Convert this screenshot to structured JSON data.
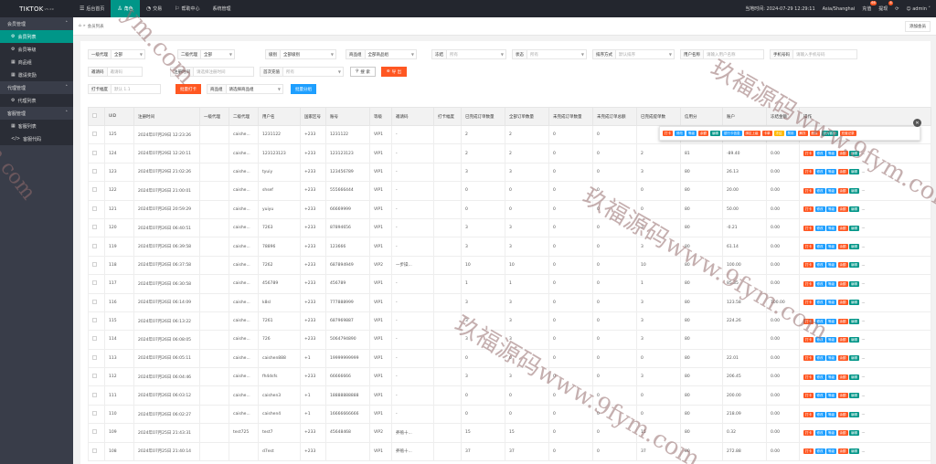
{
  "app": {
    "logo": "TIKTOK",
    "logo_sup": "V5.09"
  },
  "nav": [
    {
      "label": "后台首页",
      "icon": "☰"
    },
    {
      "label": "角色",
      "icon": "♙",
      "active": true
    },
    {
      "label": "交易",
      "icon": "◔"
    },
    {
      "label": "帮助中心",
      "icon": "⚐"
    },
    {
      "label": "系统管理",
      "icon": ""
    }
  ],
  "topright": {
    "time_label": "当地时间: 2024-07-29 12:29:11",
    "timezone": "Asia/Shanghai",
    "recharge": "充值",
    "recharge_badge": "66",
    "withdraw": "提现",
    "withdraw_badge": "6",
    "refresh_icon": "⟳",
    "user": "admin"
  },
  "sidebar": [
    {
      "type": "group",
      "label": "会员管理",
      "chev": "˄"
    },
    {
      "type": "item",
      "label": "会员列表",
      "icon": "⚙",
      "active": true
    },
    {
      "type": "item",
      "label": "会员等级",
      "icon": "⚙"
    },
    {
      "type": "item",
      "label": "商品组",
      "icon": "▦"
    },
    {
      "type": "item",
      "label": "邀请奖励",
      "icon": "▦"
    },
    {
      "type": "group",
      "label": "代理管理",
      "chev": "˄"
    },
    {
      "type": "item",
      "label": "代理列表",
      "icon": "⚙"
    },
    {
      "type": "group",
      "label": "客服管理",
      "chev": "˄"
    },
    {
      "type": "item",
      "label": "客服列表",
      "icon": "▦"
    },
    {
      "type": "item",
      "label": "客服代码",
      "icon": "</>"
    }
  ],
  "tabbar": {
    "home_icon": "⌂",
    "sep": "»",
    "tab": "会员列表",
    "add_btn": "添加会员"
  },
  "filters": {
    "agent1": {
      "label": "一级代理",
      "value": "全部"
    },
    "agent2": {
      "label": "二级代理",
      "value": "全部"
    },
    "level": {
      "label": "级别",
      "value": "全部级别"
    },
    "group": {
      "label": "商品组",
      "value": "全部商品组"
    },
    "frozen": {
      "label": "冻结",
      "value": "所有"
    },
    "status": {
      "label": "状态",
      "value": "所有"
    },
    "sort": {
      "label": "排序方式",
      "value": "默认排序"
    },
    "username": {
      "label": "用户名称",
      "value": "请输入用户名称"
    },
    "phone": {
      "label": "手机号码",
      "value": "请输入手机号码"
    },
    "invite": {
      "label": "邀请码",
      "value": "邀请码"
    },
    "regtime": {
      "label": "注册时间",
      "value": "请选择注册时间"
    },
    "first": {
      "label": "首次充值",
      "value": "所有"
    },
    "search_btn": "搜 索",
    "reset_btn": "导 出",
    "punch": {
      "label": "打卡幅度",
      "value": "默认 1.1"
    },
    "batch_punch": "批量打卡",
    "group2": {
      "label": "商品组",
      "value": "请选择商品组"
    },
    "batch_group": "批量分组"
  },
  "columns": [
    "UID",
    "注册时间",
    "一级代理",
    "二级代理",
    "用户名",
    "国家区号",
    "账号",
    "等级",
    "邀请码",
    "打卡幅度",
    "已完成订单数量",
    "全部订单数量",
    "未完成订单数量",
    "未完成订单总额",
    "已完成提单数",
    "信用分",
    "账户",
    "冻结金额",
    "操作"
  ],
  "rows": [
    [
      "125",
      "2024年07月29日 12:23:26",
      "",
      "caishe...",
      "1231122",
      "+233",
      "1231122",
      "VIP1",
      "-",
      "",
      "2",
      "2",
      "0",
      "0",
      "",
      "",
      "",
      "",
      ""
    ],
    [
      "124",
      "2024年07月29日 12:20:11",
      "",
      "caishe...",
      "123123123",
      "+233",
      "123123123",
      "VIP1",
      "-",
      "",
      "2",
      "2",
      "0",
      "0",
      "2",
      "81",
      "-89.40",
      "0.00",
      ""
    ],
    [
      "123",
      "2024年07月29日 21:02:26",
      "",
      "caishe...",
      "tyuiy",
      "+233",
      "123456789",
      "VIP1",
      "-",
      "",
      "3",
      "3",
      "0",
      "0",
      "3",
      "80",
      "26.13",
      "0.00",
      ""
    ],
    [
      "122",
      "2024年07月26日 21:00:01",
      "",
      "caishe...",
      "shsef",
      "+233",
      "555666444",
      "VIP1",
      "-",
      "",
      "0",
      "0",
      "0",
      "0",
      "0",
      "80",
      "20.00",
      "0.00",
      ""
    ],
    [
      "121",
      "2024年07月26日 20:59:29",
      "",
      "caishe...",
      "yuiyu",
      "+233",
      "66669999",
      "VIP1",
      "-",
      "",
      "0",
      "0",
      "0",
      "0",
      "0",
      "80",
      "50.00",
      "0.00",
      ""
    ],
    [
      "120",
      "2024年07月26日 06:40:51",
      "",
      "caishe...",
      "7263",
      "+233",
      "87894656",
      "VIP1",
      "-",
      "",
      "3",
      "3",
      "0",
      "0",
      "3",
      "80",
      "-0.21",
      "0.00",
      ""
    ],
    [
      "119",
      "2024年07月26日 06:39:58",
      "",
      "caishe...",
      "78896",
      "+233",
      "123666",
      "VIP1",
      "-",
      "",
      "3",
      "3",
      "0",
      "0",
      "3",
      "80",
      "61.14",
      "0.00",
      ""
    ],
    [
      "118",
      "2024年07月26日 06:37:58",
      "",
      "caishe...",
      "7262",
      "+233",
      "687894949",
      "VIP2",
      "一步操...",
      "",
      "10",
      "10",
      "0",
      "0",
      "10",
      "80",
      "100.00",
      "0.00",
      ""
    ],
    [
      "117",
      "2024年07月26日 06:30:58",
      "",
      "caishe...",
      "456789",
      "+233",
      "456789",
      "VIP1",
      "-",
      "",
      "1",
      "1",
      "0",
      "0",
      "1",
      "80",
      "85.35",
      "0.00",
      ""
    ],
    [
      "116",
      "2024年07月26日 06:14:09",
      "",
      "caishe...",
      "k8sl",
      "+233",
      "777888999",
      "VIP1",
      "-",
      "",
      "3",
      "3",
      "0",
      "0",
      "3",
      "80",
      "123.58",
      "100.00",
      ""
    ],
    [
      "115",
      "2024年07月26日 06:13:22",
      "",
      "caishe...",
      "7261",
      "+233",
      "687969887",
      "VIP1",
      "-",
      "",
      "3",
      "3",
      "0",
      "0",
      "3",
      "80",
      "224.26",
      "0.00",
      ""
    ],
    [
      "114",
      "2024年07月26日 06:08:05",
      "",
      "caishe...",
      "726",
      "+233",
      "5064794890",
      "VIP1",
      "-",
      "",
      "3",
      "3",
      "0",
      "0",
      "3",
      "80",
      "",
      "0.00",
      ""
    ],
    [
      "113",
      "2024年07月26日 06:05:11",
      "",
      "caishe...",
      "caishen888",
      "+1",
      "19999999999",
      "VIP1",
      "-",
      "",
      "0",
      "0",
      "0",
      "0",
      "0",
      "80",
      "22.01",
      "0.00",
      ""
    ],
    [
      "112",
      "2024年07月26日 06:04:46",
      "",
      "caishe...",
      "fh4dsfs",
      "+233",
      "66666666",
      "VIP1",
      "-",
      "",
      "3",
      "3",
      "0",
      "0",
      "3",
      "80",
      "206.45",
      "0.00",
      ""
    ],
    [
      "111",
      "2024年07月26日 06:03:12",
      "",
      "caishe...",
      "caishen3",
      "+1",
      "18888888888",
      "VIP1",
      "-",
      "",
      "0",
      "0",
      "0",
      "0",
      "0",
      "80",
      "200.00",
      "0.00",
      ""
    ],
    [
      "110",
      "2024年07月26日 06:02:27",
      "",
      "caishe...",
      "caishen4",
      "+1",
      "16666666666",
      "VIP1",
      "-",
      "",
      "0",
      "0",
      "0",
      "0",
      "0",
      "80",
      "218.09",
      "0.00",
      ""
    ],
    [
      "109",
      "2024年07月25日 21:43:31",
      "",
      "test725",
      "test7",
      "+233",
      "45648468",
      "VIP2",
      "养殖十...",
      "",
      "15",
      "15",
      "0",
      "0",
      "15",
      "80",
      "0.32",
      "0.00",
      ""
    ],
    [
      "108",
      "2024年07月25日 21:40:14",
      "",
      "",
      "d7est",
      "+233",
      "",
      "VIP1",
      "养殖十...",
      "",
      "37",
      "37",
      "0",
      "0",
      "37",
      "80",
      "272.88",
      "0.00",
      ""
    ]
  ],
  "row_ops": [
    {
      "label": "打卡",
      "cls": "r"
    },
    {
      "label": "修改",
      "cls": "b"
    },
    {
      "label": "等级",
      "cls": "b"
    },
    {
      "label": "余额",
      "cls": "r"
    },
    {
      "label": "编辑",
      "cls": "g"
    }
  ],
  "popover_ops": [
    {
      "label": "打卡",
      "cls": "r"
    },
    {
      "label": "修改",
      "cls": "b"
    },
    {
      "label": "等级",
      "cls": "b"
    },
    {
      "label": "余额",
      "cls": "r"
    },
    {
      "label": "编辑",
      "cls": "g"
    },
    {
      "label": "银行卡信息",
      "cls": "b"
    },
    {
      "label": "绑定上级",
      "cls": "r"
    },
    {
      "label": "卡单",
      "cls": "r"
    },
    {
      "label": "冻结",
      "cls": "o"
    },
    {
      "label": "禁用",
      "cls": "b"
    },
    {
      "label": "解冻",
      "cls": "r"
    },
    {
      "label": "删除",
      "cls": "r"
    },
    {
      "label": "设为客服",
      "cls": "g"
    },
    {
      "label": "充值记录",
      "cls": "r"
    }
  ],
  "watermark": "玖福源码www.9fym.com",
  "watermark2": "ym.com"
}
